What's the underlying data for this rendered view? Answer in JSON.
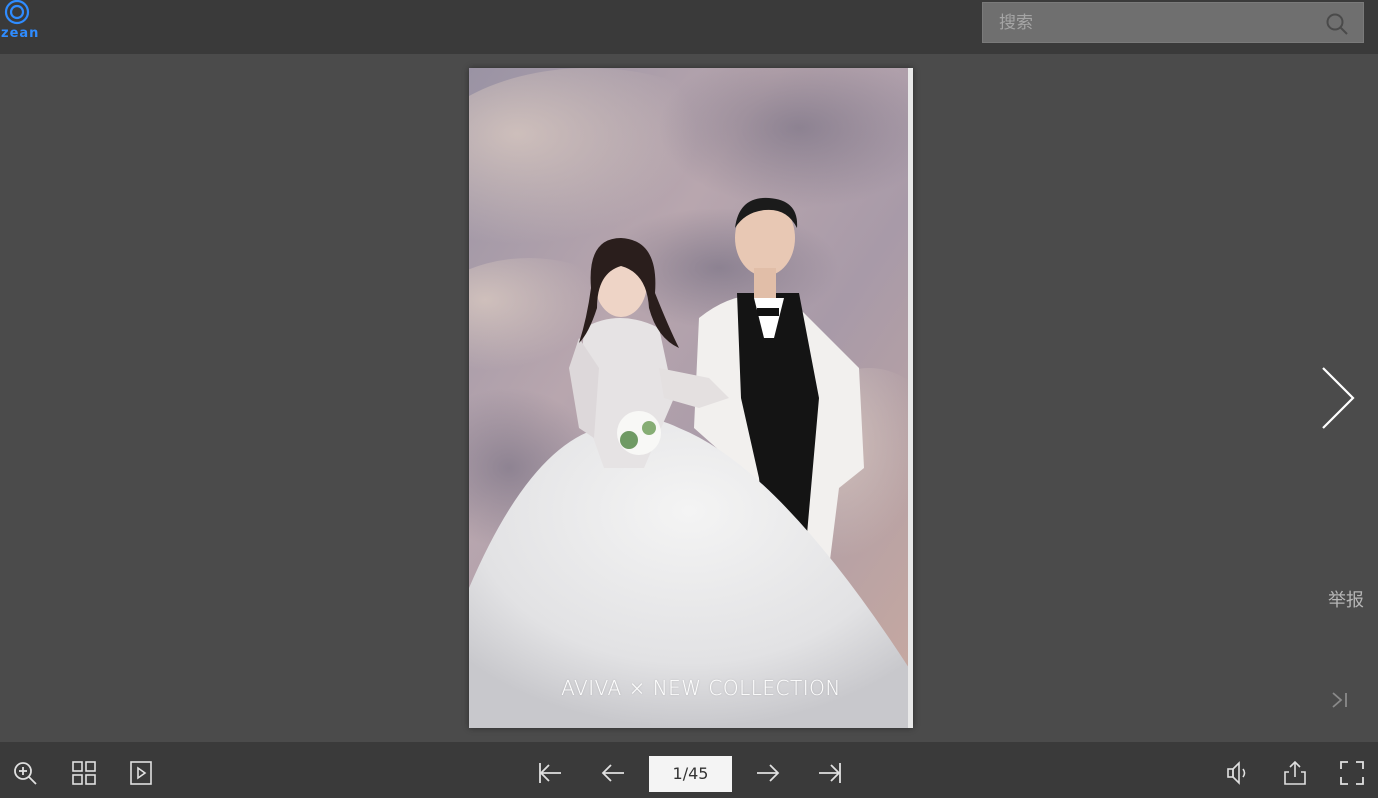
{
  "header": {
    "logo_text": "zean",
    "logo_sub": "",
    "search_placeholder": "搜索"
  },
  "page": {
    "caption": "AVIVA × NEW  COLLECTION"
  },
  "side": {
    "report_label": "举报"
  },
  "toolbar": {
    "page_indicator": "1/45",
    "icons": {
      "zoom": "zoom-in-icon",
      "thumbnails": "grid-icon",
      "autoplay": "play-icon",
      "first": "first-page-icon",
      "prev": "prev-page-icon",
      "next": "next-page-icon",
      "last": "last-page-icon",
      "sound": "sound-icon",
      "share": "share-icon",
      "fullscreen": "fullscreen-icon"
    }
  },
  "colors": {
    "background": "#4b4b4b",
    "bar": "#3a3a3a",
    "accent_logo": "#2f8cff"
  }
}
